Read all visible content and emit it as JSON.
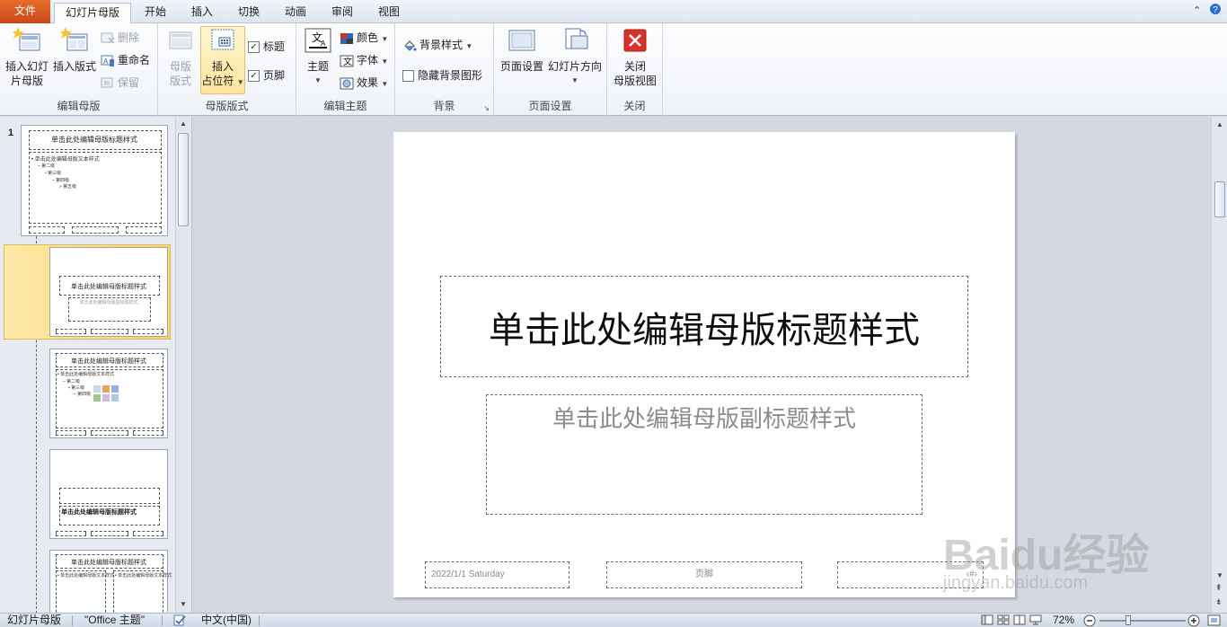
{
  "tabs": [
    {
      "label": "文件",
      "key": "file"
    },
    {
      "label": "幻灯片母版",
      "key": "slide-master",
      "active": true
    },
    {
      "label": "开始",
      "key": "home"
    },
    {
      "label": "插入",
      "key": "insert"
    },
    {
      "label": "切换",
      "key": "transitions"
    },
    {
      "label": "动画",
      "key": "animations"
    },
    {
      "label": "审阅",
      "key": "review"
    },
    {
      "label": "视图",
      "key": "view"
    }
  ],
  "ribbon": {
    "edit_master": {
      "label": "编辑母版",
      "insert_slide_master": [
        "插入幻灯",
        "片母版"
      ],
      "insert_layout": "插入版式",
      "delete": "删除",
      "rename": "重命名",
      "preserve": "保留"
    },
    "master_layout": {
      "label": "母版版式",
      "master_layout_btn": [
        "母版",
        "版式"
      ],
      "insert_placeholder": [
        "插入",
        "占位符"
      ],
      "title_check": "标题",
      "footer_check": "页脚"
    },
    "edit_theme": {
      "label": "编辑主题",
      "themes": "主题",
      "colors": "颜色",
      "fonts": "字体",
      "effects": "效果"
    },
    "background": {
      "label": "背景",
      "bg_styles": "背景样式",
      "hide_bg": "隐藏背景图形"
    },
    "page_setup": {
      "label": "页面设置",
      "page_setup_btn": "页面设置",
      "orientation": "幻灯片方向"
    },
    "close": {
      "label": "关闭",
      "close_master": [
        "关闭",
        "母版视图"
      ]
    }
  },
  "thumbnails": {
    "slide_number": "1",
    "master_title": "单击此处编辑母版标题样式",
    "master_text": "单击此处编辑母版文本样式",
    "level2": "第二级",
    "level3": "第三级",
    "level4": "第四级",
    "level5": "第五级",
    "subtitle": "单击此处编辑母版副标题样式"
  },
  "slide": {
    "title": "单击此处编辑母版标题样式",
    "subtitle": "单击此处编辑母版副标题样式",
    "date": "2022/1/1 Saturday",
    "footer": "页脚",
    "page_number": "‹#›"
  },
  "status": {
    "view": "幻灯片母版",
    "theme": "\"Office 主题\"",
    "language": "中文(中国)",
    "zoom": "72%"
  },
  "watermark": {
    "text": "Baidu经验",
    "url": "jingyan.baidu.com"
  },
  "colors": {
    "file_tab": "#d3541f",
    "accent": "#fbd46c"
  }
}
